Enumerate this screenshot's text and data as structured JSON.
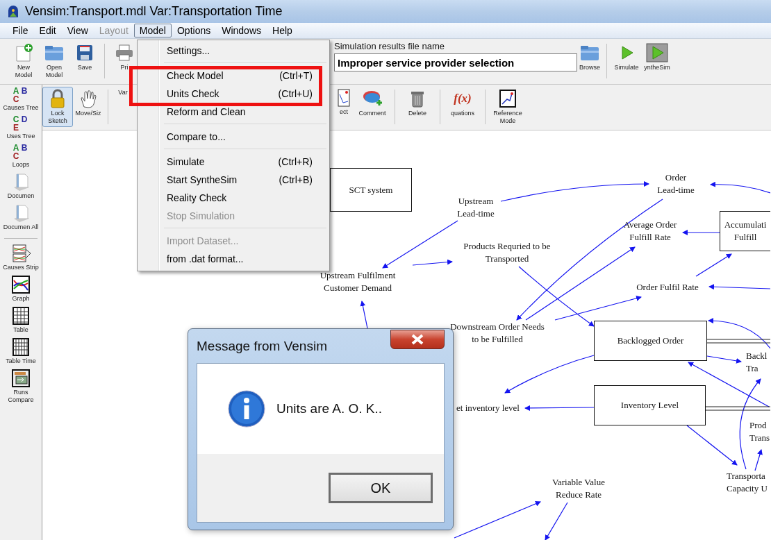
{
  "window": {
    "title": "Vensim:Transport.mdl Var:Transportation Time"
  },
  "menu_bar": [
    {
      "label": "File",
      "disabled": false,
      "selected": false
    },
    {
      "label": "Edit",
      "disabled": false,
      "selected": false
    },
    {
      "label": "View",
      "disabled": false,
      "selected": false
    },
    {
      "label": "Layout",
      "disabled": true,
      "selected": false
    },
    {
      "label": "Model",
      "disabled": false,
      "selected": true
    },
    {
      "label": "Options",
      "disabled": false,
      "selected": false
    },
    {
      "label": "Windows",
      "disabled": false,
      "selected": false
    },
    {
      "label": "Help",
      "disabled": false,
      "selected": false
    }
  ],
  "toolbar_top": {
    "tools": [
      {
        "label": "New Model",
        "selected": false
      },
      {
        "label": "Open Model",
        "selected": false
      },
      {
        "label": "Save",
        "selected": false
      },
      {
        "label": "Pri",
        "selected": false
      }
    ],
    "results_file": {
      "label": "Simulation results file name",
      "value": "Improper service provider selection"
    },
    "actions": [
      {
        "label": "Browse",
        "selected": false
      },
      {
        "label": "Simulate",
        "selected": false
      },
      {
        "label": "yntheSim",
        "selected": false
      }
    ]
  },
  "toolbar_sketch": {
    "tools_left": [
      {
        "label": "Lock Sketch",
        "selected": true
      },
      {
        "label": "Move/Siz",
        "selected": false
      },
      {
        "label": "Var",
        "selected": false
      }
    ],
    "tools_right": [
      {
        "label": "ect",
        "selected": false
      },
      {
        "label": "Comment",
        "selected": false
      },
      {
        "label": "Delete",
        "selected": false
      },
      {
        "label": "quations",
        "selected": false,
        "icon_text": "f(x)"
      },
      {
        "label": "Reference Mode",
        "selected": false
      }
    ]
  },
  "sidebar": {
    "items": [
      {
        "kind": "tool",
        "label": "Causes Tree",
        "icon_letters": [
          "A",
          "B",
          "C"
        ]
      },
      {
        "kind": "tool",
        "label": "Uses Tree",
        "icon_letters": [
          "C",
          "D",
          "E"
        ]
      },
      {
        "kind": "tool",
        "label": "Loops",
        "icon_letters": [
          "A",
          "B",
          "C"
        ]
      },
      {
        "kind": "tool",
        "label": "Documen"
      },
      {
        "kind": "tool",
        "label": "Documen All"
      },
      {
        "kind": "separator"
      },
      {
        "kind": "tool",
        "label": "Causes Strip"
      },
      {
        "kind": "tool",
        "label": "Graph"
      },
      {
        "kind": "tool",
        "label": "Table"
      },
      {
        "kind": "tool",
        "label": "Table Time"
      },
      {
        "kind": "tool",
        "label": "Runs Compare"
      }
    ]
  },
  "model_menu": {
    "items": [
      {
        "kind": "item",
        "label": "Settings...",
        "disabled": false
      },
      {
        "kind": "separator"
      },
      {
        "kind": "item",
        "label": "Check Model",
        "shortcut": "(Ctrl+T)",
        "disabled": false
      },
      {
        "kind": "item",
        "label": "Units Check",
        "shortcut": "(Ctrl+U)",
        "disabled": false
      },
      {
        "kind": "item",
        "label": "Reform and Clean",
        "disabled": false
      },
      {
        "kind": "separator"
      },
      {
        "kind": "item",
        "label": "Compare to...",
        "disabled": false
      },
      {
        "kind": "separator"
      },
      {
        "kind": "item",
        "label": "Simulate",
        "shortcut": "(Ctrl+R)",
        "disabled": false
      },
      {
        "kind": "item",
        "label": "Start SyntheSim",
        "shortcut": "(Ctrl+B)",
        "disabled": false
      },
      {
        "kind": "item",
        "label": "Reality Check",
        "disabled": false
      },
      {
        "kind": "item",
        "label": "Stop Simulation",
        "disabled": true
      },
      {
        "kind": "separator"
      },
      {
        "kind": "item",
        "label": "Import Dataset...",
        "disabled": true
      },
      {
        "kind": "item",
        "label": "from .dat format...",
        "disabled": false
      }
    ]
  },
  "diagram": {
    "nodes": [
      {
        "kind": "stock",
        "lines": [
          "SCT system"
        ]
      },
      {
        "kind": "variable",
        "lines": [
          "Upstream",
          "Lead-time"
        ]
      },
      {
        "kind": "variable",
        "lines": [
          "Order",
          "Lead-time"
        ]
      },
      {
        "kind": "variable",
        "lines": [
          "Average Order",
          "Fulfill Rate"
        ]
      },
      {
        "kind": "stock",
        "lines": [
          "Accumulati",
          "Fulfill"
        ]
      },
      {
        "kind": "variable",
        "lines": [
          "Products Requried to be",
          "Transported"
        ]
      },
      {
        "kind": "variable",
        "lines": [
          "Upstream Fulfilment",
          "Customer Demand"
        ]
      },
      {
        "kind": "variable",
        "lines": [
          "Order Fulfil Rate"
        ]
      },
      {
        "kind": "variable",
        "lines": [
          "Downstream Order Needs",
          "to be Fulfilled"
        ]
      },
      {
        "kind": "stock",
        "lines": [
          "Backlogged Order"
        ]
      },
      {
        "kind": "variable",
        "lines": [
          "Backl",
          "Tra"
        ]
      },
      {
        "kind": "variable",
        "lines": [
          "et inventory level"
        ]
      },
      {
        "kind": "stock",
        "lines": [
          "Inventory Level"
        ]
      },
      {
        "kind": "variable",
        "lines": [
          "Prod",
          "Trans"
        ]
      },
      {
        "kind": "variable",
        "lines": [
          "Variable Value",
          "Reduce Rate"
        ]
      },
      {
        "kind": "variable",
        "lines": [
          "Transporta",
          "Capacity U"
        ]
      }
    ]
  },
  "dialog": {
    "title": "Message from Vensim",
    "message": "Units are A. O. K..",
    "buttons": [
      "OK"
    ]
  }
}
